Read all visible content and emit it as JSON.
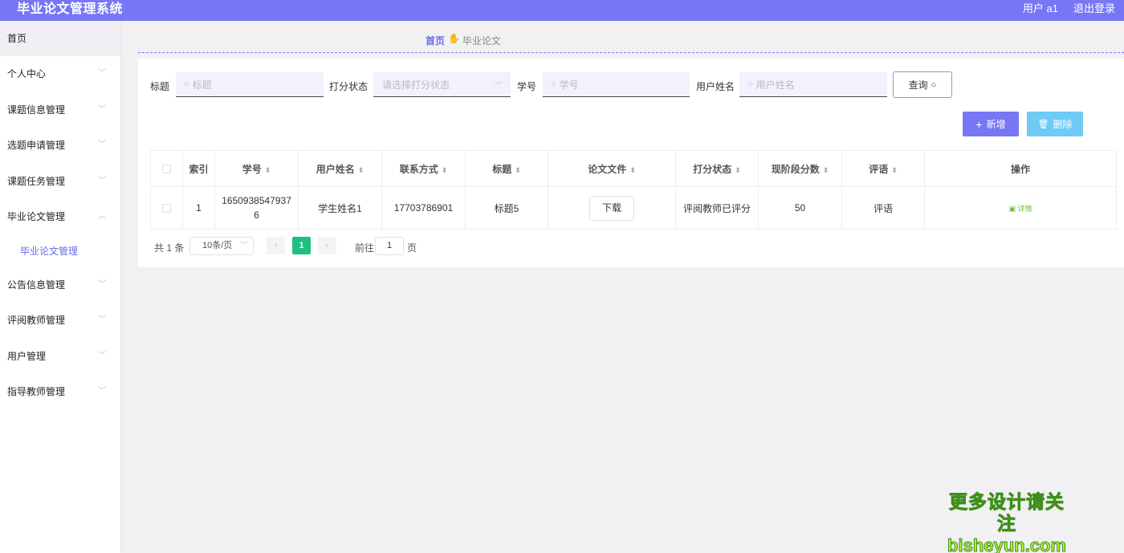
{
  "header": {
    "app_title": "毕业论文管理系统",
    "user_label": "用户 a1",
    "logout_label": "退出登录"
  },
  "sidebar": {
    "home_label": "首页",
    "items": [
      {
        "label": "个人中心",
        "expanded": false
      },
      {
        "label": "课题信息管理",
        "expanded": false
      },
      {
        "label": "选题申请管理",
        "expanded": false
      },
      {
        "label": "课题任务管理",
        "expanded": false
      },
      {
        "label": "毕业论文管理",
        "expanded": true,
        "children": [
          "毕业论文管理"
        ]
      },
      {
        "label": "公告信息管理",
        "expanded": false
      },
      {
        "label": "评阅教师管理",
        "expanded": false
      },
      {
        "label": "用户管理",
        "expanded": false
      },
      {
        "label": "指导教师管理",
        "expanded": false
      }
    ]
  },
  "breadcrumb": {
    "home": "首页",
    "icon": "hand-icon",
    "current": "毕业论文"
  },
  "search": {
    "title_label": "标题",
    "title_placeholder": "标题",
    "status_label": "打分状态",
    "status_placeholder": "请选择打分状态",
    "student_no_label": "学号",
    "student_no_placeholder": "学号",
    "username_label": "用户姓名",
    "username_placeholder": "用户姓名",
    "query_button": "查询"
  },
  "actions": {
    "add_label": "新增",
    "delete_label": "删除"
  },
  "table": {
    "columns": [
      "索引",
      "学号",
      "用户姓名",
      "联系方式",
      "标题",
      "论文文件",
      "打分状态",
      "现阶段分数",
      "评语",
      "操作"
    ],
    "rows": [
      {
        "index": "1",
        "student_no": "16509385479376",
        "username": "学生姓名1",
        "contact": "17703786901",
        "title": "标题5",
        "file_button": "下载",
        "status": "评阅教师已评分",
        "score": "50",
        "comment": "评语",
        "op_detail": "详情"
      }
    ]
  },
  "pagination": {
    "total_text": "共 1 条",
    "page_size": "10条/页",
    "current_page": "1",
    "goto_prefix": "前往",
    "goto_value": "1",
    "goto_suffix": "页"
  },
  "watermark": {
    "line1": "更多设计请关注",
    "line2": "bisheyun.com"
  },
  "colors": {
    "primary": "#7777f5",
    "info": "#6ecbf5",
    "success": "#1fbf82",
    "link": "#67c23a"
  }
}
